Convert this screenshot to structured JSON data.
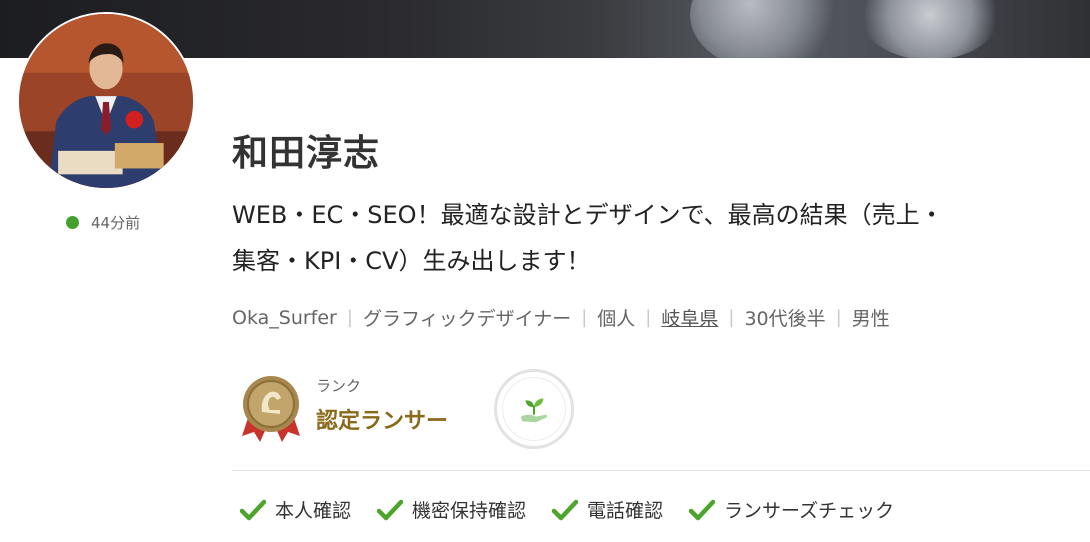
{
  "profile": {
    "name": "和田淳志",
    "catchphrase_line1": "WEB・EC・SEO！最適な設計とデザインで、最高の結果（売上・",
    "catchphrase_line2": "集客・KPI・CV）生み出します！",
    "last_active": "44分前",
    "online_color": "#44a12d"
  },
  "meta": {
    "username": "Oka_Surfer",
    "occupation": "グラフィックデザイナー",
    "type": "個人",
    "location": "岐阜県",
    "age": "30代後半",
    "gender": "男性"
  },
  "rank": {
    "label": "ランク",
    "name": "認定ランサー",
    "badge_icon": "certified-rank-medal-icon",
    "secondary_badge_icon": "sprout-hand-icon",
    "name_color": "#8a6a1a"
  },
  "verifications": {
    "check_color": "#4ea52b",
    "items": [
      "本人確認",
      "機密保持確認",
      "電話確認",
      "ランサーズチェック"
    ]
  }
}
